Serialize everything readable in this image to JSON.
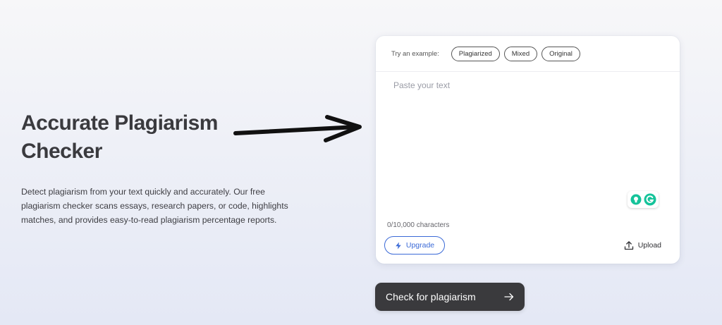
{
  "hero": {
    "title": "Accurate Plagiarism Checker",
    "description": "Detect plagiarism from your text quickly and accurately. Our free plagiarism checker scans essays, research papers, or code, highlights matches, and provides easy-to-read plagiarism percentage reports."
  },
  "examples": {
    "label": "Try an example:",
    "options": [
      "Plagiarized",
      "Mixed",
      "Original"
    ]
  },
  "editor": {
    "value": "",
    "placeholder": "Paste your text",
    "char_count": "0/10,000 characters",
    "helper_icons": [
      "lightbulb-icon",
      "grammarly-icon"
    ]
  },
  "actions": {
    "upgrade_label": "Upgrade",
    "upload_label": "Upload",
    "check_label": "Check for plagiarism"
  },
  "colors": {
    "accent_blue": "#3b6ad7",
    "primary_button": "#3a3a3d",
    "grammarly_green": "#15c39a"
  }
}
